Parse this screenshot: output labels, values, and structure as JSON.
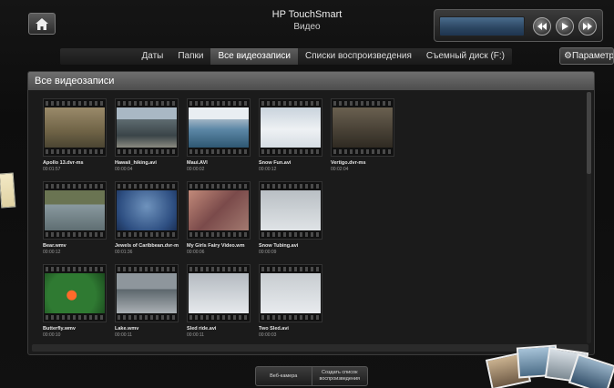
{
  "header": {
    "app_name": "HP TouchSmart",
    "section": "Видео"
  },
  "tabs": [
    {
      "label": "Даты",
      "active": false
    },
    {
      "label": "Папки",
      "active": false
    },
    {
      "label": "Все видеозаписи",
      "active": true
    },
    {
      "label": "Списки воспроизведения",
      "active": false
    },
    {
      "label": "Съемный диск (F:)",
      "active": false
    }
  ],
  "settings_label": "Параметры",
  "panel": {
    "title": "Все видеозаписи",
    "videos": [
      {
        "name": "Apollo 13.dvr-ms",
        "duration": "00:01:57",
        "scene": "apollo"
      },
      {
        "name": "Hawaii_hiking.avi",
        "duration": "00:00:04",
        "scene": "hawaii"
      },
      {
        "name": "Maui.AVI",
        "duration": "00:00:02",
        "scene": "maui"
      },
      {
        "name": "Snow Fun.avi",
        "duration": "00:00:12",
        "scene": "snowfun"
      },
      {
        "name": "Vertigo.dvr-ms",
        "duration": "00:02:04",
        "scene": "vertigo"
      },
      {
        "name": "Bear.wmv",
        "duration": "00:00:12",
        "scene": "bear"
      },
      {
        "name": "Jewels of Caribbean.dvr-m",
        "duration": "00:01:36",
        "scene": "jewels"
      },
      {
        "name": "My Girls Fairy Video.wm",
        "duration": "00:00:06",
        "scene": "fairy"
      },
      {
        "name": "Snow Tubing.avi",
        "duration": "00:00:09",
        "scene": "tubing"
      },
      {
        "name": "Butterfly.wmv",
        "duration": "00:00:10",
        "scene": "butterfly"
      },
      {
        "name": "Lake.wmv",
        "duration": "00:00:11",
        "scene": "lake"
      },
      {
        "name": "Sled ride.avi",
        "duration": "00:00:11",
        "scene": "sled"
      },
      {
        "name": "Two Sled.avi",
        "duration": "00:00:03",
        "scene": "twosled"
      }
    ]
  },
  "bottom": {
    "webcam_label": "Веб-камера",
    "create_playlist_label": "Создать список воспроизведения"
  },
  "icons": {
    "home": "home-icon",
    "rewind": "rewind-icon",
    "play": "play-icon",
    "fast_forward": "fast-forward-icon",
    "settings": "gear-icon"
  }
}
